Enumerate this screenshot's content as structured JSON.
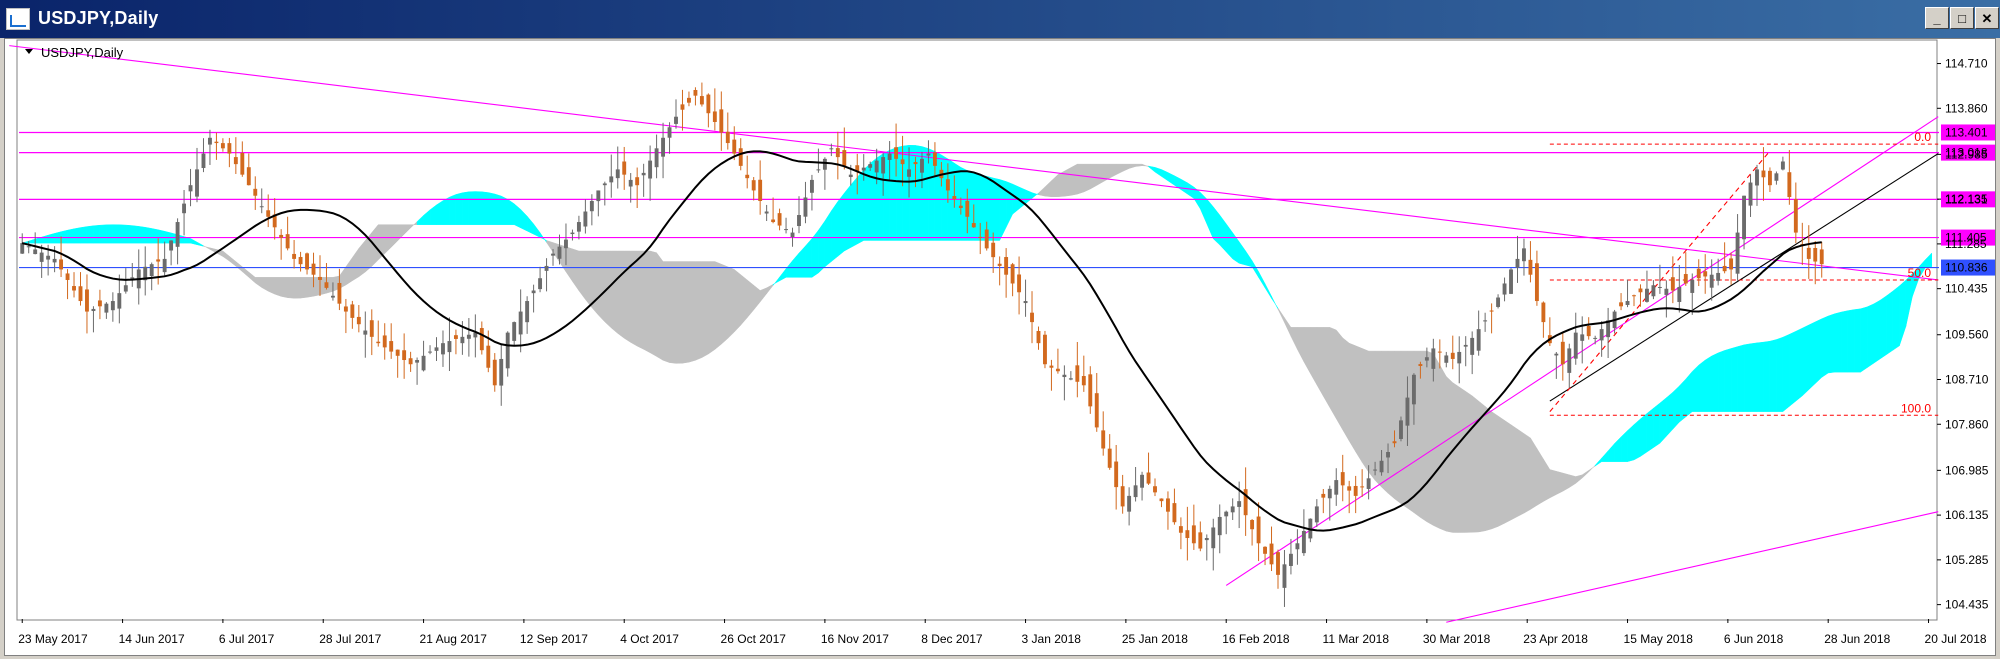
{
  "window": {
    "title": "USDJPY,Daily",
    "minimize": "_",
    "maximize": "□",
    "close": "✕"
  },
  "chart_data": {
    "type": "candlestick",
    "title": "USDJPY,Daily",
    "symbol": "USDJPY",
    "timeframe": "Daily",
    "ylim": [
      104.2,
      115.1
    ],
    "x_ticks": [
      "23 May 2017",
      "14 Jun 2017",
      "6 Jul 2017",
      "28 Jul 2017",
      "21 Aug 2017",
      "12 Sep 2017",
      "4 Oct 2017",
      "26 Oct 2017",
      "16 Nov 2017",
      "8 Dec 2017",
      "3 Jan 2018",
      "25 Jan 2018",
      "16 Feb 2018",
      "11 Mar 2018",
      "30 Mar 2018",
      "23 Apr 2018",
      "15 May 2018",
      "6 Jun 2018",
      "28 Jun 2018",
      "20 Jul 2018"
    ],
    "y_ticks": [
      114.71,
      113.86,
      112.985,
      112.135,
      111.285,
      110.435,
      109.56,
      108.71,
      107.86,
      106.985,
      106.135,
      105.285,
      104.435
    ],
    "price_levels": [
      {
        "label": "113.401",
        "value": 113.401,
        "color": "#ff00ff"
      },
      {
        "label": "113.018",
        "value": 113.018,
        "color": "#ff00ff"
      },
      {
        "label": "112.131",
        "value": 112.131,
        "color": "#ff00ff"
      },
      {
        "label": "111.405",
        "value": 111.405,
        "color": "#ff00ff"
      },
      {
        "label": "110.836",
        "value": 110.836,
        "color": "#3050ff"
      }
    ],
    "fibonacci": [
      {
        "label": "0.0",
        "value": 113.18
      },
      {
        "label": "50.0",
        "value": 110.6
      },
      {
        "label": "100.0",
        "value": 108.03
      }
    ],
    "close_key_points": [
      [
        0,
        111.3
      ],
      [
        5,
        111.0
      ],
      [
        10,
        110.0
      ],
      [
        14,
        110.2
      ],
      [
        18,
        110.8
      ],
      [
        22,
        111.0
      ],
      [
        26,
        112.4
      ],
      [
        29,
        113.3
      ],
      [
        32,
        113.0
      ],
      [
        36,
        112.2
      ],
      [
        39,
        111.6
      ],
      [
        42,
        111.0
      ],
      [
        46,
        110.6
      ],
      [
        50,
        110.0
      ],
      [
        55,
        109.4
      ],
      [
        60,
        109.0
      ],
      [
        65,
        109.4
      ],
      [
        70,
        109.6
      ],
      [
        73,
        108.6
      ],
      [
        75,
        109.6
      ],
      [
        79,
        110.4
      ],
      [
        82,
        111.1
      ],
      [
        85,
        111.5
      ],
      [
        89,
        112.3
      ],
      [
        92,
        112.7
      ],
      [
        95,
        112.4
      ],
      [
        98,
        113.1
      ],
      [
        101,
        113.7
      ],
      [
        104,
        114.1
      ],
      [
        107,
        113.6
      ],
      [
        110,
        113.0
      ],
      [
        113,
        112.3
      ],
      [
        116,
        111.7
      ],
      [
        119,
        111.5
      ],
      [
        122,
        112.5
      ],
      [
        125,
        113.1
      ],
      [
        128,
        112.6
      ],
      [
        131,
        112.8
      ],
      [
        134,
        113.0
      ],
      [
        137,
        112.7
      ],
      [
        140,
        113.0
      ],
      [
        143,
        112.3
      ],
      [
        146,
        111.8
      ],
      [
        149,
        111.2
      ],
      [
        152,
        110.7
      ],
      [
        155,
        110.2
      ],
      [
        158,
        109.0
      ],
      [
        161,
        108.8
      ],
      [
        164,
        108.6
      ],
      [
        167,
        107.4
      ],
      [
        170,
        106.3
      ],
      [
        173,
        106.9
      ],
      [
        176,
        106.4
      ],
      [
        179,
        105.8
      ],
      [
        182,
        105.5
      ],
      [
        185,
        106.1
      ],
      [
        188,
        106.4
      ],
      [
        191,
        105.6
      ],
      [
        194,
        105.0
      ],
      [
        197,
        105.6
      ],
      [
        200,
        106.3
      ],
      [
        203,
        106.8
      ],
      [
        206,
        106.5
      ],
      [
        209,
        107.0
      ],
      [
        212,
        107.5
      ],
      [
        215,
        108.8
      ],
      [
        218,
        109.3
      ],
      [
        221,
        109.1
      ],
      [
        224,
        109.5
      ],
      [
        227,
        110.0
      ],
      [
        230,
        110.8
      ],
      [
        232,
        111.2
      ],
      [
        234,
        110.2
      ],
      [
        236,
        109.4
      ],
      [
        238,
        109.0
      ],
      [
        240,
        109.6
      ],
      [
        243,
        109.5
      ],
      [
        246,
        110.0
      ],
      [
        249,
        110.3
      ],
      [
        252,
        110.5
      ],
      [
        255,
        110.4
      ],
      [
        258,
        110.6
      ],
      [
        261,
        110.7
      ],
      [
        264,
        110.8
      ],
      [
        266,
        112.2
      ],
      [
        268,
        112.7
      ],
      [
        270,
        112.4
      ],
      [
        272,
        112.85
      ],
      [
        274,
        111.5
      ],
      [
        276,
        111.0
      ],
      [
        278,
        110.9
      ]
    ]
  }
}
